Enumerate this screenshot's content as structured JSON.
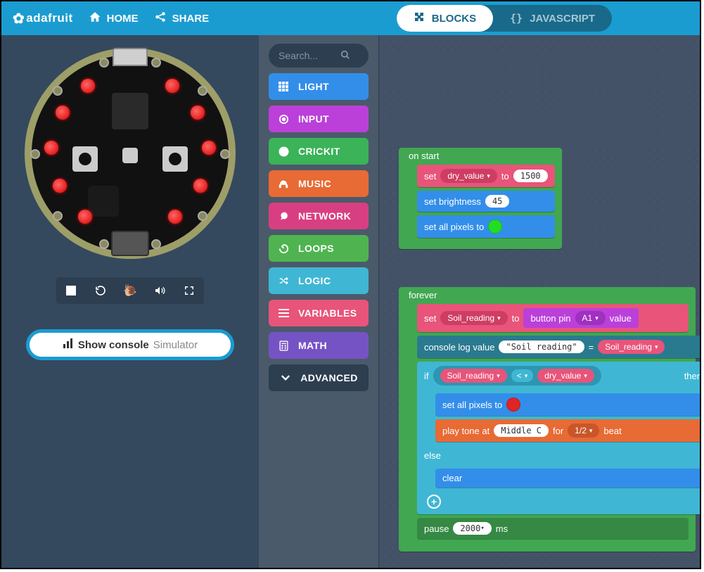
{
  "header": {
    "brand": "adafruit",
    "home": "HOME",
    "share": "SHARE",
    "tab_blocks": "BLOCKS",
    "tab_js": "JAVASCRIPT"
  },
  "sim": {
    "console_bold": "Show console",
    "console_light": "Simulator"
  },
  "toolbox": {
    "search_placeholder": "Search...",
    "light": "LIGHT",
    "input": "INPUT",
    "crickit": "CRICKIT",
    "music": "MUSIC",
    "network": "NETWORK",
    "loops": "LOOPS",
    "logic": "LOGIC",
    "variables": "VARIABLES",
    "math": "MATH",
    "advanced": "ADVANCED"
  },
  "onstart": {
    "title": "on start",
    "set": "set",
    "dry_value": "dry_value",
    "to": "to",
    "val1500": "1500",
    "set_brightness": "set brightness",
    "val45": "45",
    "set_all_pixels_to": "set all pixels to",
    "color_green": "#22dd22"
  },
  "forever": {
    "title": "forever",
    "set": "set",
    "soil_reading": "Soil_reading",
    "to": "to",
    "button_pin": "button pin",
    "a1": "A1",
    "value": "value",
    "console_log_value": "console log value",
    "soil_reading_str": "\"Soil reading\"",
    "eq": "=",
    "if": "if",
    "lt": "<",
    "dry_value": "dry_value",
    "then": "then",
    "set_all_pixels_to": "set all pixels to",
    "color_red": "#e02424",
    "play_tone_at": "play tone at",
    "middle_c": "Middle C",
    "for": "for",
    "half": "1/2",
    "beat": "beat",
    "else": "else",
    "clear": "clear",
    "pause": "pause",
    "val2000": "2000",
    "ms": "ms"
  }
}
